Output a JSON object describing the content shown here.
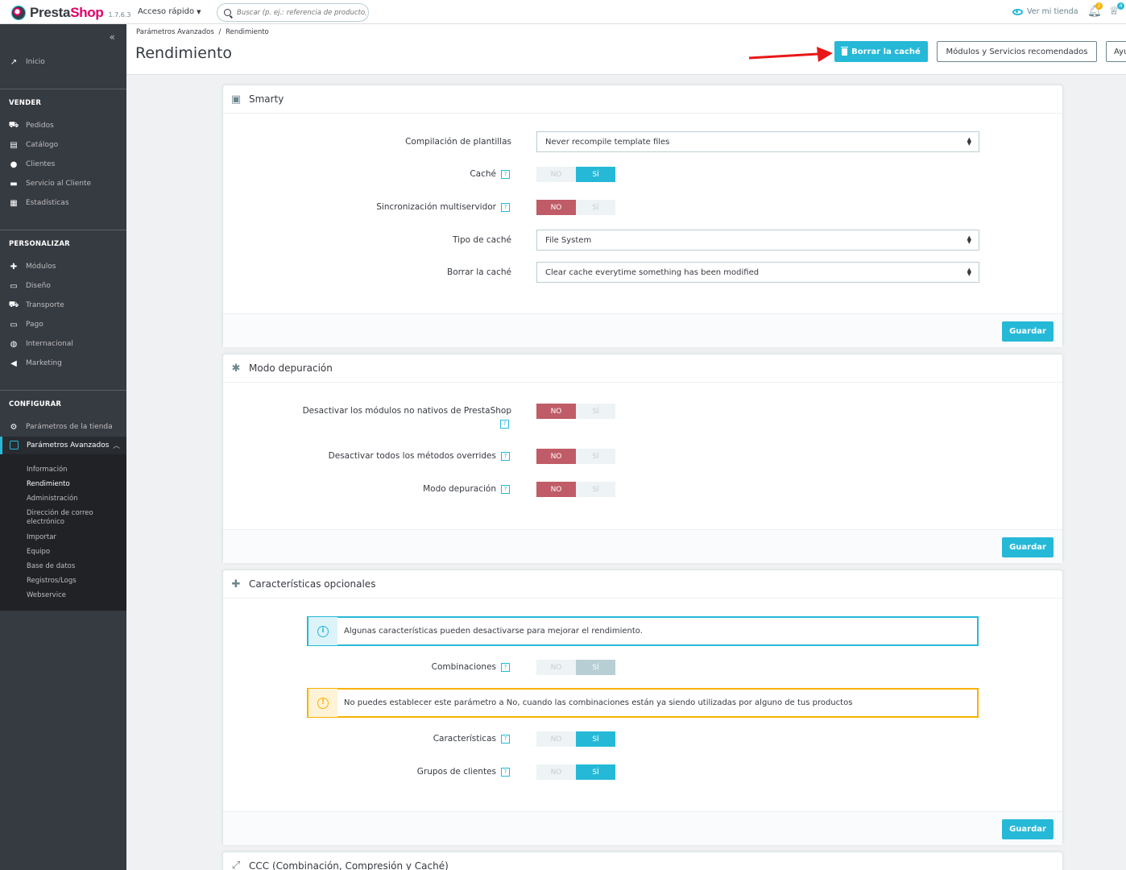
{
  "topbar": {
    "brand_a": "Presta",
    "brand_b": "Shop",
    "version": "1.7.6.3",
    "quick_access": "Acceso rápido",
    "search_placeholder": "Buscar (p. ej.: referencia de producto, n",
    "view_shop": "Ver mi tienda",
    "notif_badge_1": "2",
    "notif_badge_2": "4"
  },
  "sidebar": {
    "collapse": "«",
    "home": "Inicio",
    "sections": {
      "sell": "VENDER",
      "customize": "PERSONALIZAR",
      "configure": "CONFIGURAR"
    },
    "sell_items": [
      "Pedidos",
      "Catálogo",
      "Clientes",
      "Servicio al Cliente",
      "Estadísticas"
    ],
    "customize_items": [
      "Módulos",
      "Diseño",
      "Transporte",
      "Pago",
      "Internacional",
      "Marketing"
    ],
    "configure_items": [
      "Parámetros de la tienda",
      "Parámetros Avanzados"
    ],
    "submenu": [
      "Información",
      "Rendimiento",
      "Administración",
      "Dirección de correo electrónico",
      "Importar",
      "Equipo",
      "Base de datos",
      "Registros/Logs",
      "Webservice"
    ]
  },
  "header": {
    "breadcrumb_1": "Parámetros Avanzados",
    "breadcrumb_sep": "/",
    "breadcrumb_2": "Rendimiento",
    "title": "Rendimiento",
    "clear_cache": "Borrar la caché",
    "recommended": "Módulos y Servicios recomendados",
    "help": "Ayu"
  },
  "smarty": {
    "title": "Smarty",
    "template_compilation_label": "Compilación de plantillas",
    "template_compilation_value": "Never recompile template files",
    "cache_label": "Caché",
    "multiserver_label": "Sincronización multiservidor",
    "cache_type_label": "Tipo de caché",
    "cache_type_value": "File System",
    "clear_cache_label": "Borrar la caché",
    "clear_cache_value": "Clear cache everytime something has been modified",
    "save": "Guardar"
  },
  "debug": {
    "title": "Modo depuración",
    "disable_non_native_label": "Desactivar los módulos no nativos de PrestaShop",
    "disable_overrides_label": "Desactivar todos los métodos overrides",
    "debug_mode_label": "Modo depuración",
    "save": "Guardar"
  },
  "optional": {
    "title": "Características opcionales",
    "info_text": "Algunas características pueden desactivarse para mejorar el rendimiento.",
    "combinations_label": "Combinaciones",
    "warning_text": "No puedes establecer este parámetro a No, cuando las combinaciones están ya siendo utilizadas por alguno de tus productos",
    "features_label": "Características",
    "groups_label": "Grupos de clientes",
    "save": "Guardar"
  },
  "ccc": {
    "title": "CCC (Combinación, Compresión y Caché)"
  },
  "switch": {
    "no": "NO",
    "yes": "SÍ"
  },
  "help_glyph": "?",
  "colors": {
    "accent": "#25b9d7",
    "danger": "#c05c67",
    "sidebar": "#363a41",
    "warning": "#fab000"
  }
}
